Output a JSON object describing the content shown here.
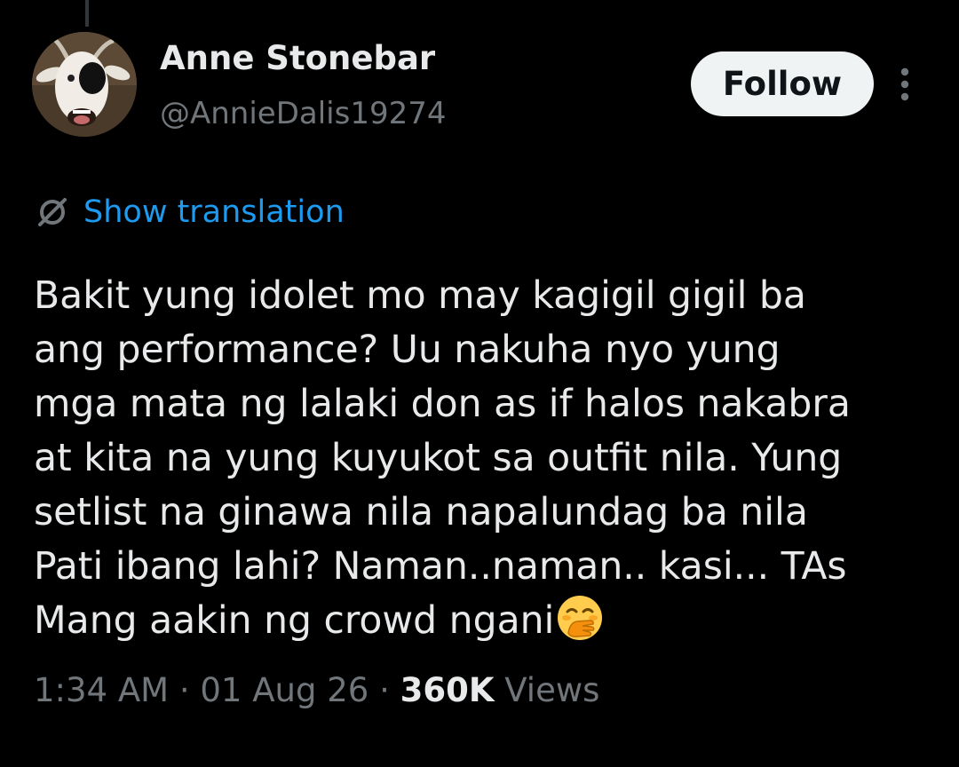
{
  "author": {
    "display_name": "Anne Stonebar",
    "handle": "@AnnieDalis19274",
    "avatar_icon": "goat-avatar"
  },
  "actions": {
    "follow_label": "Follow",
    "more_icon": "more-vertical-icon"
  },
  "translation": {
    "icon": "globe-translate-icon",
    "label": "Show translation"
  },
  "tweet": {
    "lines": [
      "Bakit yung idolet mo may kagigil gigil ba",
      "ang performance? Uu nakuha nyo yung",
      "mga mata ng lalaki don as if halos nakabra",
      "at kita na yung kuyukot sa outfit nila. Yung",
      "setlist na ginawa nila napalundag ba nila",
      "Pati ibang lahi? Naman..naman.. kasi... TAs",
      "Mang aakin ng crowd ngani"
    ],
    "trailing_emoji": "face-with-hand-over-mouth"
  },
  "meta": {
    "time": "1:34 AM",
    "separator": "·",
    "date": "01 Aug 26",
    "views_count": "360K",
    "views_label": "Views"
  },
  "colors": {
    "background": "#000000",
    "primary_text": "#e7e9ea",
    "secondary_text": "#71767b",
    "link": "#1d9bf0",
    "follow_bg": "#eff3f4"
  }
}
